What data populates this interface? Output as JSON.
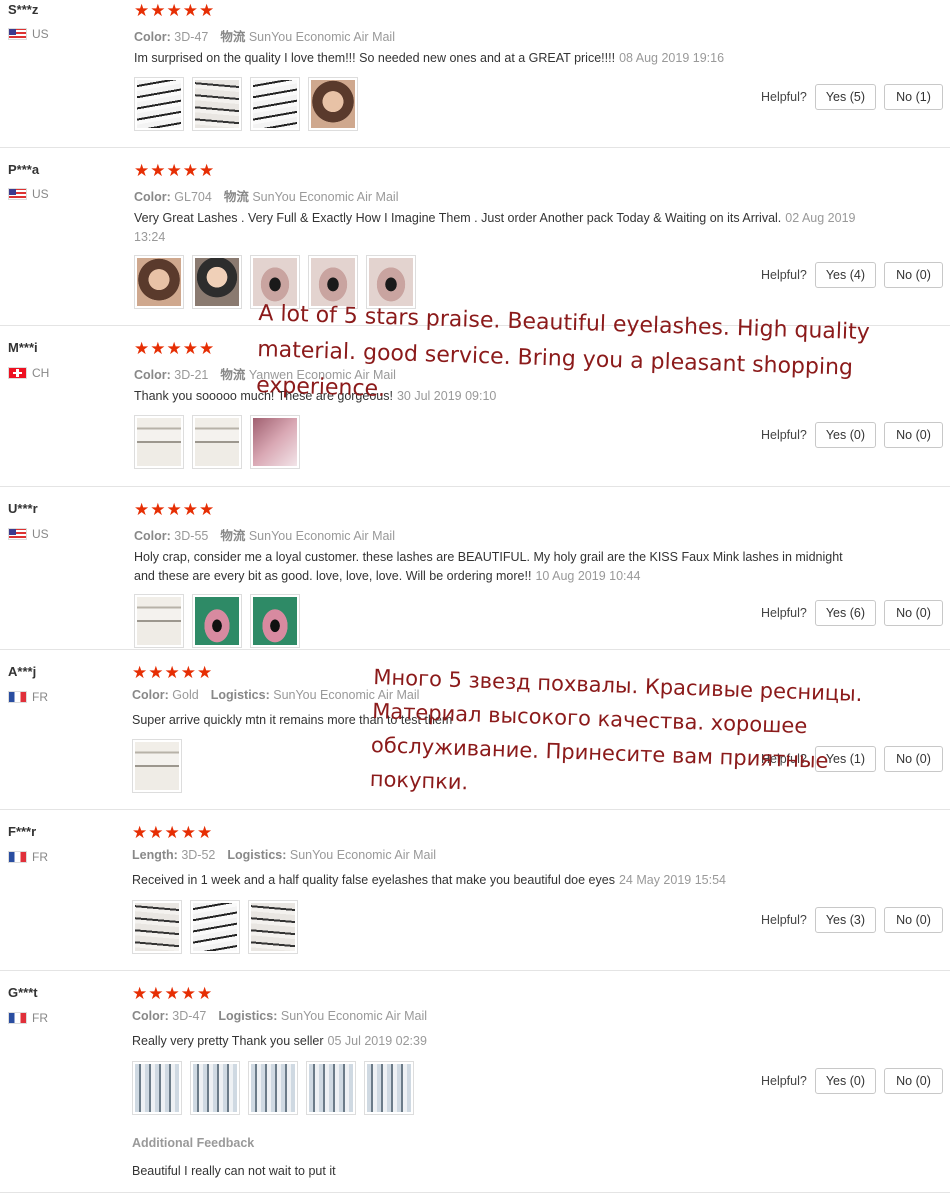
{
  "reviews": [
    {
      "user": "S***z",
      "country": "US",
      "flag": "us",
      "stars": "★★★★★",
      "meta_label": "Color:",
      "meta_value": "3D-47",
      "logistics_label": "物流",
      "logistics_value": "SunYou Economic Air Mail",
      "text": "Im surprised on the quality I love them!!! So needed new ones and at a GREAT price!!!!",
      "date": "08 Aug 2019 19:16",
      "helpful_label": "Helpful?",
      "yes": "Yes (5)",
      "no": "No (1)"
    },
    {
      "user": "P***a",
      "country": "US",
      "flag": "us",
      "stars": "★★★★★",
      "meta_label": "Color:",
      "meta_value": "GL704",
      "logistics_label": "物流",
      "logistics_value": "SunYou Economic Air Mail",
      "text": "Very Great Lashes . Very Full & Exactly How I Imagine Them . Just order Another pack Today & Waiting on its Arrival.",
      "date": "02 Aug 2019 13:24",
      "helpful_label": "Helpful?",
      "yes": "Yes (4)",
      "no": "No (0)"
    },
    {
      "user": "M***i",
      "country": "CH",
      "flag": "ch",
      "stars": "★★★★★",
      "meta_label": "Color:",
      "meta_value": "3D-21",
      "logistics_label": "物流",
      "logistics_value": "Yanwen Economic Air Mail",
      "text": "Thank you sooooo much! These are gorgeous!",
      "date": "30 Jul 2019 09:10",
      "helpful_label": "Helpful?",
      "yes": "Yes (0)",
      "no": "No (0)"
    },
    {
      "user": "U***r",
      "country": "US",
      "flag": "us",
      "stars": "★★★★★",
      "meta_label": "Color:",
      "meta_value": "3D-55",
      "logistics_label": "物流",
      "logistics_value": "SunYou Economic Air Mail",
      "text": "Holy crap, consider me a loyal customer. these lashes are BEAUTIFUL. My holy grail are the KISS Faux Mink lashes in midnight and these are every bit as good. love, love, love. Will be ordering more!!",
      "date": "10 Aug 2019 10:44",
      "helpful_label": "Helpful?",
      "yes": "Yes (6)",
      "no": "No (0)"
    },
    {
      "user": "A***j",
      "country": "FR",
      "flag": "fr",
      "stars": "★★★★★",
      "meta_label": "Color:",
      "meta_value": "Gold",
      "logistics_label": "Logistics:",
      "logistics_value": "SunYou Economic Air Mail",
      "text": "Super arrive quickly mtn it remains more than to test them",
      "date": "",
      "helpful_label": "Helpful?",
      "yes": "Yes (1)",
      "no": "No (0)"
    },
    {
      "user": "F***r",
      "country": "FR",
      "flag": "fr",
      "stars": "★★★★★",
      "meta_label": "Length:",
      "meta_value": "3D-52",
      "logistics_label": "Logistics:",
      "logistics_value": "SunYou Economic Air Mail",
      "text": "Received in 1 week and a half quality false eyelashes that make you beautiful doe eyes",
      "date": "24 May 2019 15:54",
      "helpful_label": "Helpful?",
      "yes": "Yes (3)",
      "no": "No (0)"
    },
    {
      "user": "G***t",
      "country": "FR",
      "flag": "fr",
      "stars": "★★★★★",
      "meta_label": "Color:",
      "meta_value": "3D-47",
      "logistics_label": "Logistics:",
      "logistics_value": "SunYou Economic Air Mail",
      "text": "Really very pretty Thank you seller",
      "date": "05 Jul 2019 02:39",
      "helpful_label": "Helpful?",
      "yes": "Yes (0)",
      "no": "No (0)",
      "additional_label": "Additional Feedback",
      "additional_text": "Beautiful I really can not wait to put it"
    }
  ],
  "overlay_en": {
    "line1": "A lot of 5 stars praise. Beautiful eyelashes. High quality",
    "line2": "material. good service. Bring you a pleasant shopping",
    "line3": "experience."
  },
  "overlay_ru": {
    "line1": "Много 5 звезд похвалы. Красивые ресницы.",
    "line2": "Материал высокого качества. хорошее",
    "line3": "обслуживание. Принесите вам приятные",
    "line4": "покупки."
  }
}
